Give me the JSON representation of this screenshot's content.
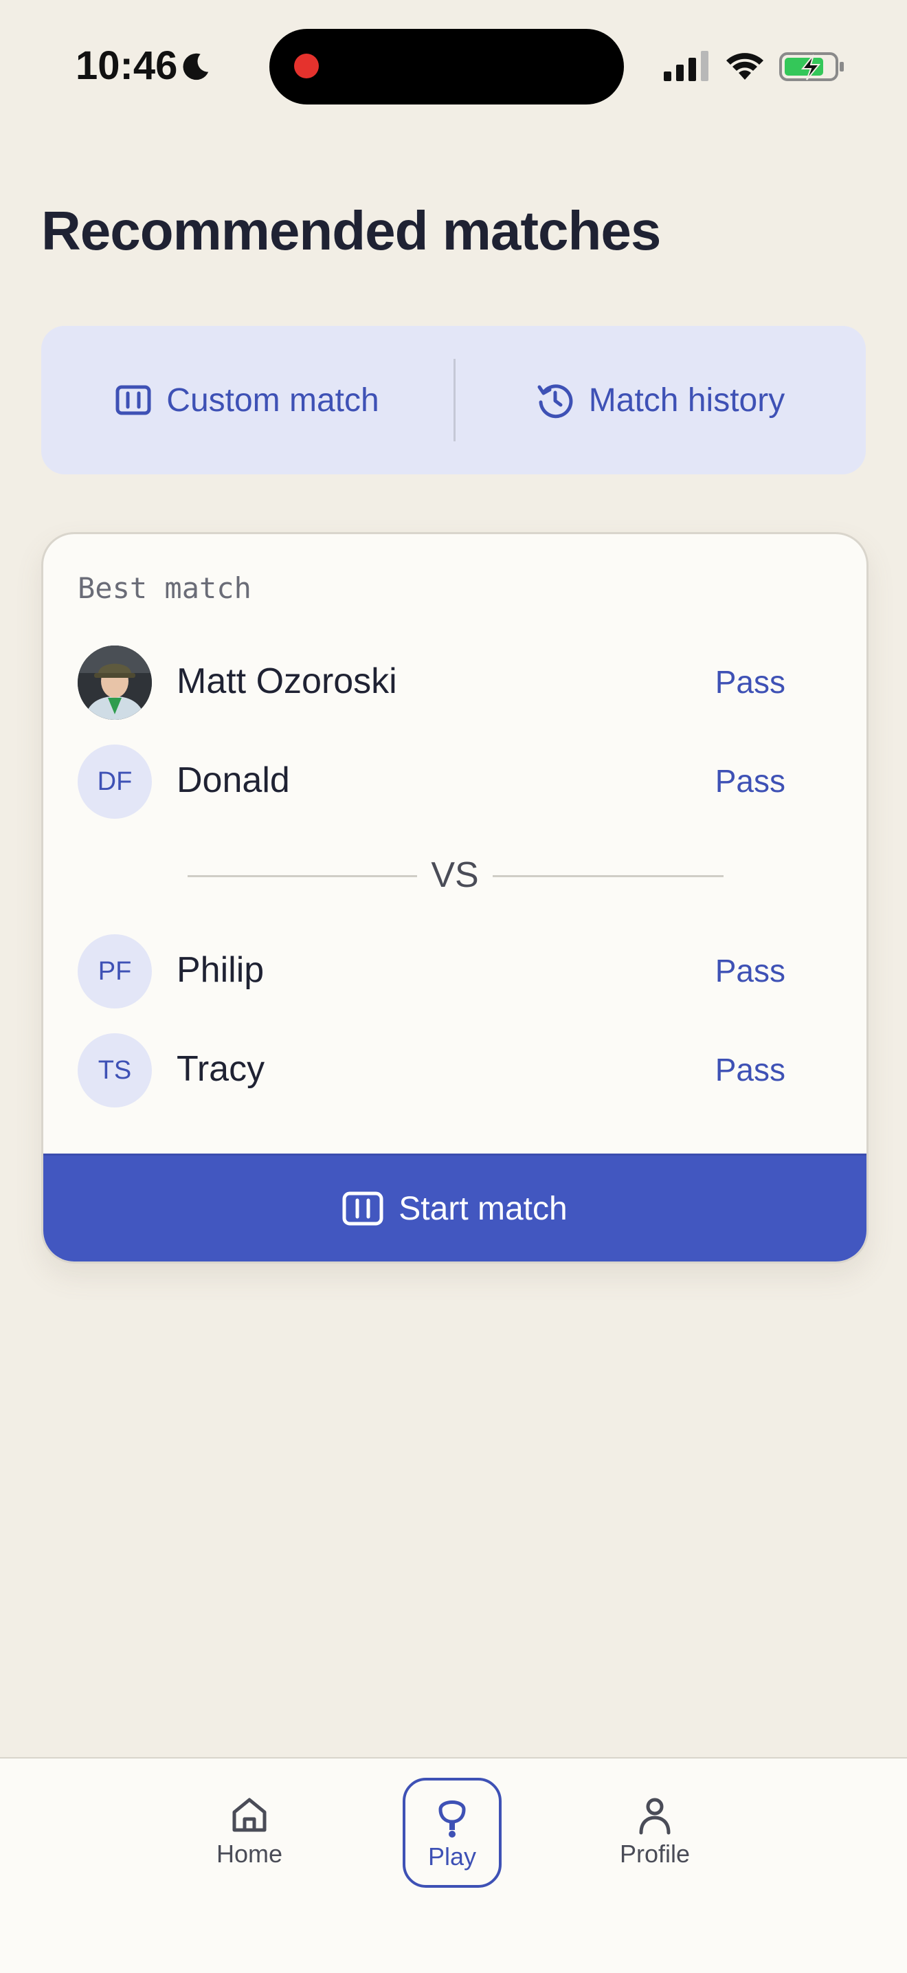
{
  "status_bar": {
    "time": "10:46",
    "icons": [
      "moon-icon",
      "recording-dot",
      "signal-icon",
      "wifi-icon",
      "battery-charging-icon"
    ],
    "colors": {
      "recording": "#E5322D",
      "battery": "#34C759"
    }
  },
  "page": {
    "title": "Recommended matches"
  },
  "actions": {
    "custom_match": {
      "label": "Custom match",
      "icon": "court-icon"
    },
    "match_history": {
      "label": "Match history",
      "icon": "history-icon"
    }
  },
  "match_card": {
    "label": "Best match",
    "team_a": [
      {
        "name": "Matt Ozoroski",
        "initials": "",
        "avatar": "photo",
        "action": "Pass"
      },
      {
        "name": "Donald",
        "initials": "DF",
        "action": "Pass"
      }
    ],
    "vs_label": "VS",
    "team_b": [
      {
        "name": "Philip",
        "initials": "PF",
        "action": "Pass"
      },
      {
        "name": "Tracy",
        "initials": "TS",
        "action": "Pass"
      }
    ],
    "start_button": {
      "label": "Start match",
      "icon": "court-icon"
    }
  },
  "tab_bar": {
    "home": {
      "label": "Home",
      "icon": "home-icon"
    },
    "play": {
      "label": "Play",
      "icon": "paddle-icon",
      "active": true
    },
    "profile": {
      "label": "Profile",
      "icon": "person-icon"
    }
  },
  "colors": {
    "background": "#F2EEE5",
    "accent": "#3E51B5",
    "accent_fill": "#4257C0",
    "soft_accent": "#E3E6F7",
    "card": "#FCFBF7"
  }
}
